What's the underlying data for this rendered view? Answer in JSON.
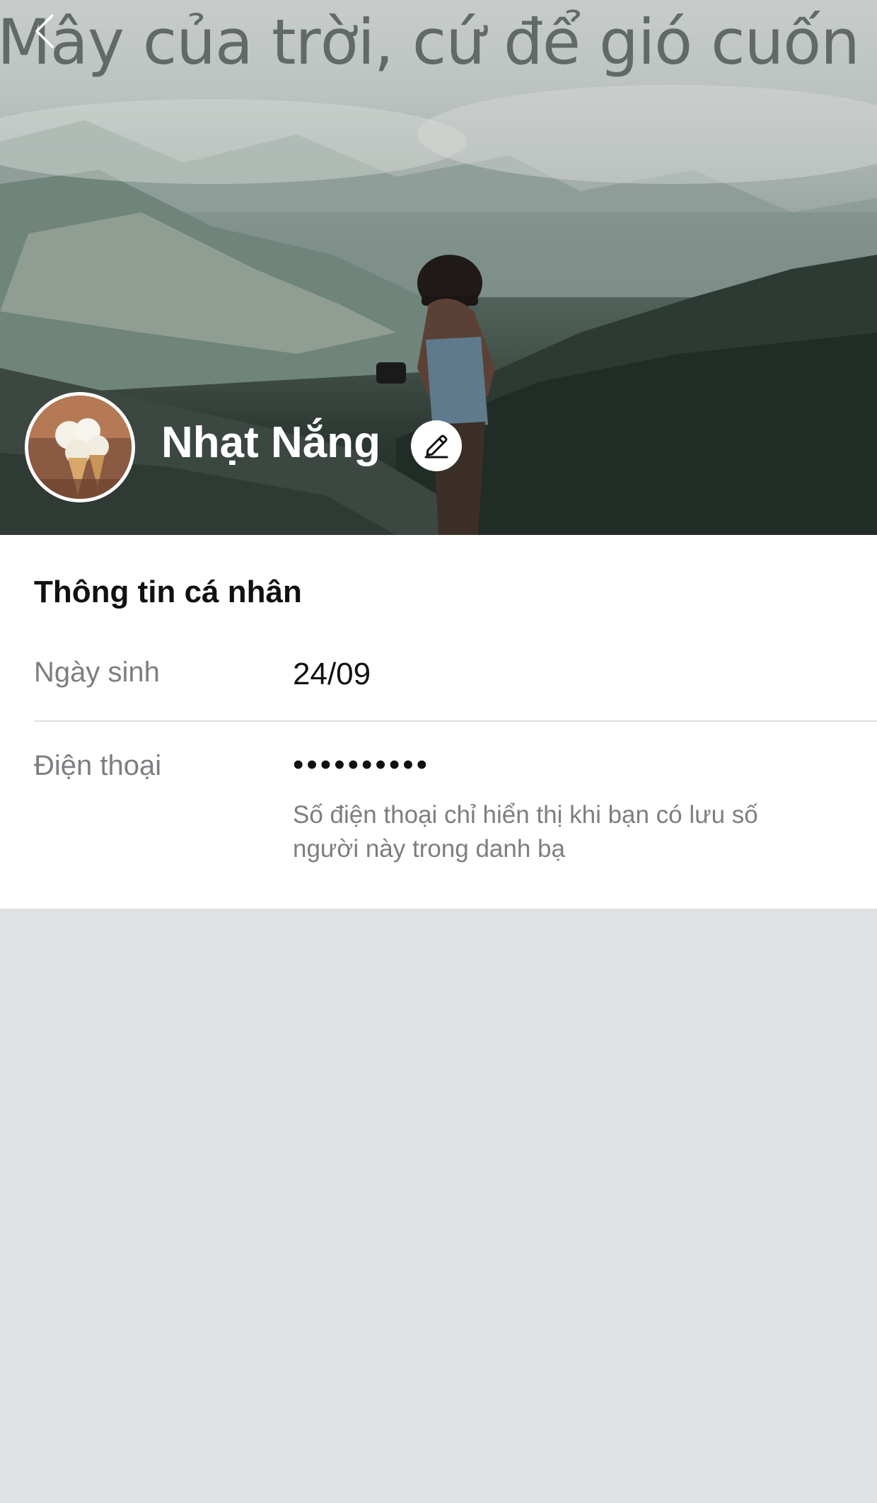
{
  "cover": {
    "caption": "Mây của trời, cứ để gió cuốn đi"
  },
  "header": {
    "back_icon": "chevron-left-icon",
    "profile_name": "Nhạt Nắng",
    "edit_icon": "pencil-icon"
  },
  "info": {
    "section_title": "Thông tin cá nhân",
    "birthday_label": "Ngày sinh",
    "birthday_value": "24/09",
    "phone_label": "Điện thoại",
    "phone_value": "••••••••••",
    "phone_note": "Số điện thoại chỉ hiển thị khi bạn có lưu số người này trong danh bạ"
  }
}
